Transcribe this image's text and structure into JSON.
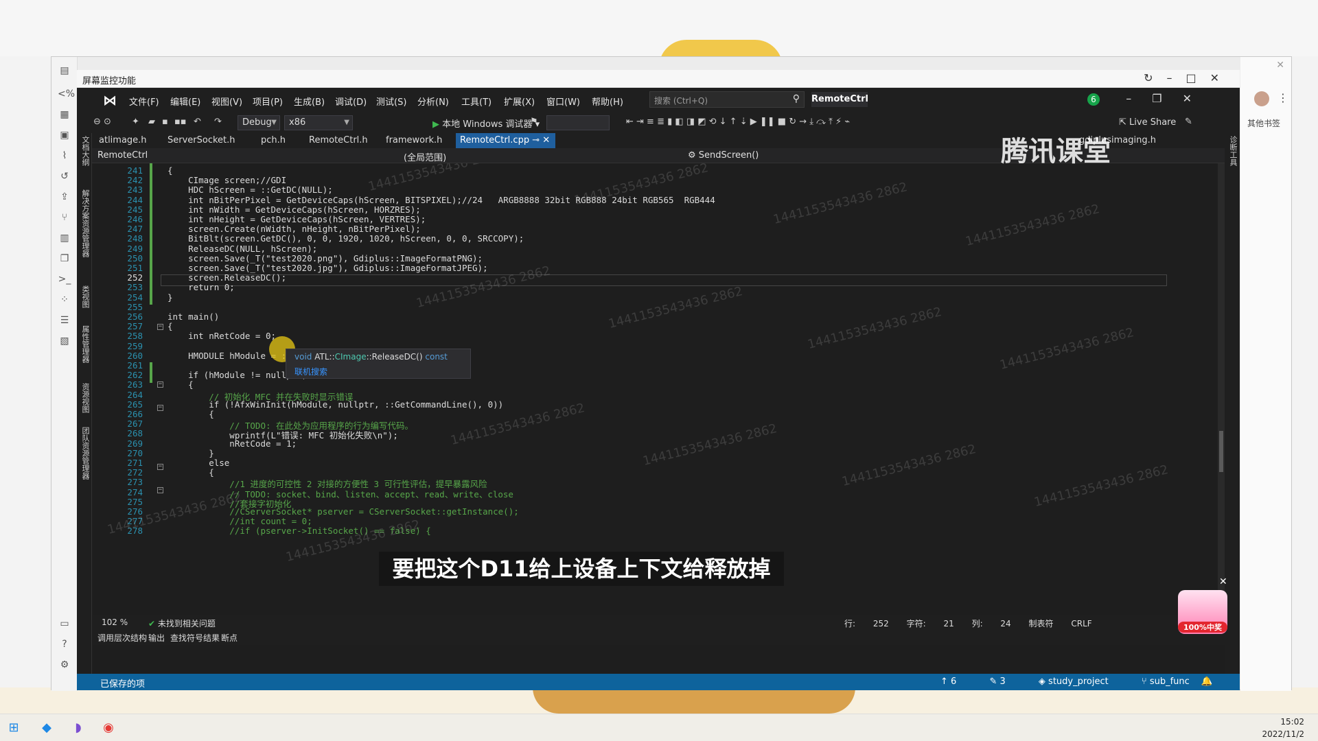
{
  "outer": {
    "title": "屏幕监控功能",
    "favorites": "其他书签"
  },
  "vs": {
    "menu": [
      "文件(F)",
      "编辑(E)",
      "视图(V)",
      "项目(P)",
      "生成(B)",
      "调试(D)",
      "测试(S)",
      "分析(N)",
      "工具(T)",
      "扩展(X)",
      "窗口(W)",
      "帮助(H)"
    ],
    "search_placeholder": "搜索 (Ctrl+Q)",
    "project_name": "RemoteCtrl",
    "notif_count": "6",
    "config": "Debug",
    "platform": "x86",
    "run_label": "本地 Windows 调试器",
    "live_share": "Live Share",
    "left_tools": [
      "文档大纲",
      "解决方案资源管理器",
      "类视图",
      "属性管理器",
      "资源视图",
      "团队资源管理器"
    ],
    "right_tools": [
      "诊断工具"
    ],
    "tabs": [
      "atlimage.h",
      "ServerSocket.h",
      "pch.h",
      "RemoteCtrl.h",
      "framework.h",
      "RemoteCtrl.cpp"
    ],
    "tab_right": "gdiplusimaging.h",
    "nav": {
      "project": "RemoteCtrl",
      "scope": "(全局范围)",
      "member": "SendScreen()"
    },
    "tooltip": {
      "sig_void": "void",
      "sig_ns": "ATL::",
      "sig_class": "CImage",
      "sig_rest": "::ReleaseDC() ",
      "sig_const": "const",
      "link": "联机搜索"
    },
    "status": {
      "zoom": "102 %",
      "issues": "未找到相关问题",
      "line": "行: 252",
      "char": "字符: 21",
      "col": "列: 24",
      "tab": "制表符",
      "eol": "CRLF"
    },
    "panels": [
      "调用层次结构",
      "输出",
      "查找符号结果",
      "断点"
    ],
    "statusbar": {
      "saved": "已保存的项",
      "up": "6",
      "edit": "3",
      "repo": "study_project",
      "branch": "sub_func"
    },
    "watermark": "1441153543436 2862"
  },
  "subtitle": "要把这个D11给上设备上下文给释放掉",
  "tencent": "腾讯课堂",
  "promo": "100%中奖",
  "clock": {
    "time": "15:02",
    "date": "2022/11/2"
  },
  "code_lines": [
    {
      "n": "241",
      "t": "{"
    },
    {
      "n": "242",
      "t": "    CImage screen;//GDI"
    },
    {
      "n": "243",
      "t": "    HDC hScreen = ::GetDC(NULL);"
    },
    {
      "n": "244",
      "t": "    int nBitPerPixel = GetDeviceCaps(hScreen, BITSPIXEL);//24   ARGB8888 32bit RGB888 24bit RGB565  RGB444"
    },
    {
      "n": "245",
      "t": "    int nWidth = GetDeviceCaps(hScreen, HORZRES);"
    },
    {
      "n": "246",
      "t": "    int nHeight = GetDeviceCaps(hScreen, VERTRES);"
    },
    {
      "n": "247",
      "t": "    screen.Create(nWidth, nHeight, nBitPerPixel);"
    },
    {
      "n": "248",
      "t": "    BitBlt(screen.GetDC(), 0, 0, 1920, 1020, hScreen, 0, 0, SRCCOPY);"
    },
    {
      "n": "249",
      "t": "    ReleaseDC(NULL, hScreen);"
    },
    {
      "n": "250",
      "t": "    screen.Save(_T(\"test2020.png\"), Gdiplus::ImageFormatPNG);"
    },
    {
      "n": "251",
      "t": "    screen.Save(_T(\"test2020.jpg\"), Gdiplus::ImageFormatJPEG);"
    },
    {
      "n": "252",
      "t": "    screen.ReleaseDC();"
    },
    {
      "n": "253",
      "t": "    return 0;"
    },
    {
      "n": "254",
      "t": "}"
    },
    {
      "n": "255",
      "t": ""
    },
    {
      "n": "256",
      "t": "int main()"
    },
    {
      "n": "257",
      "t": "{"
    },
    {
      "n": "258",
      "t": "    int nRetCode = 0;"
    },
    {
      "n": "259",
      "t": ""
    },
    {
      "n": "260",
      "t": "    HMODULE hModule = ::GetModuleHandle(nullptr);"
    },
    {
      "n": "261",
      "t": ""
    },
    {
      "n": "262",
      "t": "    if (hModule != nullptr)"
    },
    {
      "n": "263",
      "t": "    {"
    },
    {
      "n": "264",
      "t": "        // 初始化 MFC 并在失败时显示错误"
    },
    {
      "n": "265",
      "t": "        if (!AfxWinInit(hModule, nullptr, ::GetCommandLine(), 0))"
    },
    {
      "n": "266",
      "t": "        {"
    },
    {
      "n": "267",
      "t": "            // TODO: 在此处为应用程序的行为编写代码。"
    },
    {
      "n": "268",
      "t": "            wprintf(L\"错误: MFC 初始化失败\\n\");"
    },
    {
      "n": "269",
      "t": "            nRetCode = 1;"
    },
    {
      "n": "270",
      "t": "        }"
    },
    {
      "n": "271",
      "t": "        else"
    },
    {
      "n": "272",
      "t": "        {"
    },
    {
      "n": "273",
      "t": "            //1 进度的可控性 2 对接的方便性 3 可行性评估，提早暴露风险"
    },
    {
      "n": "274",
      "t": "            // TODO: socket、bind、listen、accept、read、write、close"
    },
    {
      "n": "275",
      "t": "            //套接字初始化"
    },
    {
      "n": "276",
      "t": "            //CServerSocket* pserver = CServerSocket::getInstance();"
    },
    {
      "n": "277",
      "t": "            //int count = 0;"
    },
    {
      "n": "278",
      "t": "            //if (pserver->InitSocket() == false) {"
    }
  ]
}
